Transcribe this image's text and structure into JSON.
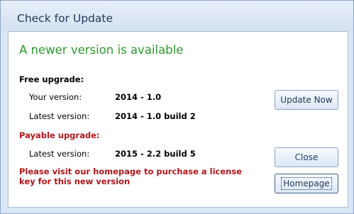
{
  "dialog": {
    "title": "Check for Update",
    "headline": "A newer version is available",
    "free_upgrade": {
      "heading": "Free upgrade:",
      "your_version_label": "Your version:",
      "your_version_value": "2014 - 1.0",
      "latest_version_label": "Latest version:",
      "latest_version_value": "2014 - 1.0 build 2"
    },
    "payable_upgrade": {
      "heading": "Payable upgrade:",
      "latest_version_label": "Latest version:",
      "latest_version_value": "2015 - 2.2 build 5",
      "notice_line1": "Please visit our homepage to purchase a license",
      "notice_line2": "key for this new version"
    },
    "buttons": {
      "update_now": "Update Now",
      "close": "Close",
      "homepage": "Homepage"
    },
    "colors": {
      "headline": "#2b9a2b",
      "payable": "#b1161a",
      "title_text": "#1e395b"
    }
  }
}
